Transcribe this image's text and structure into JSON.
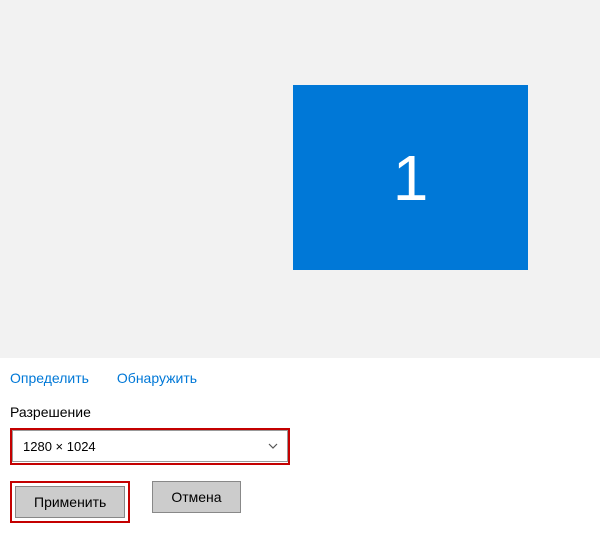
{
  "preview": {
    "monitor_number": "1"
  },
  "links": {
    "identify": "Определить",
    "detect": "Обнаружить"
  },
  "resolution": {
    "label": "Разрешение",
    "selected": "1280 × 1024"
  },
  "buttons": {
    "apply": "Применить",
    "cancel": "Отмена"
  },
  "colors": {
    "accent": "#0078d7",
    "highlight": "#c40000"
  }
}
